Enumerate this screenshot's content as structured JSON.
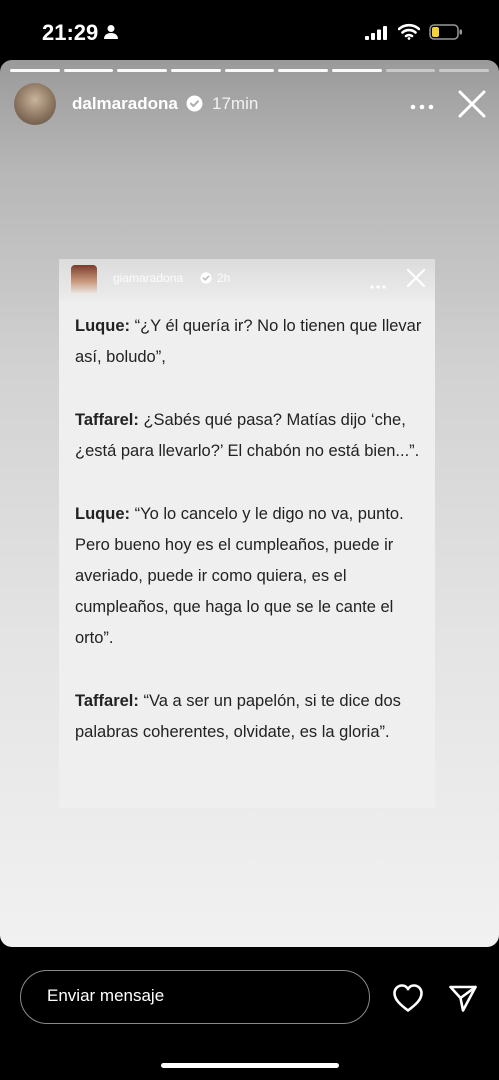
{
  "status_bar": {
    "time": "21:29"
  },
  "story": {
    "segments_total": 9,
    "segments_viewed": 7,
    "username": "dalmaradona",
    "time_ago": "17min"
  },
  "shared_post": {
    "username": "giamaradona",
    "time_ago": "2h",
    "paragraphs": [
      {
        "speaker": "Luque:",
        "text": " “¿Y él quería ir? No lo tienen que llevar así, boludo”,"
      },
      {
        "speaker": "Taffarel:",
        "text": " ¿Sabés qué pasa? Matías dijo ‘che, ¿está para llevarlo?’ El chabón no está bien...”."
      },
      {
        "speaker": "Luque:",
        "text": " “Yo lo cancelo y le digo no va, punto. Pero bueno hoy es el cumpleaños, puede ir averiado, puede ir como quiera, es el cumpleaños, que haga lo que se le cante el orto”."
      },
      {
        "speaker": "Taffarel:",
        "text": " “Va a ser un papelón, si te dice dos palabras coherentes, olvidate, es la gloria”."
      }
    ]
  },
  "message_bar": {
    "placeholder": "Enviar mensaje"
  }
}
